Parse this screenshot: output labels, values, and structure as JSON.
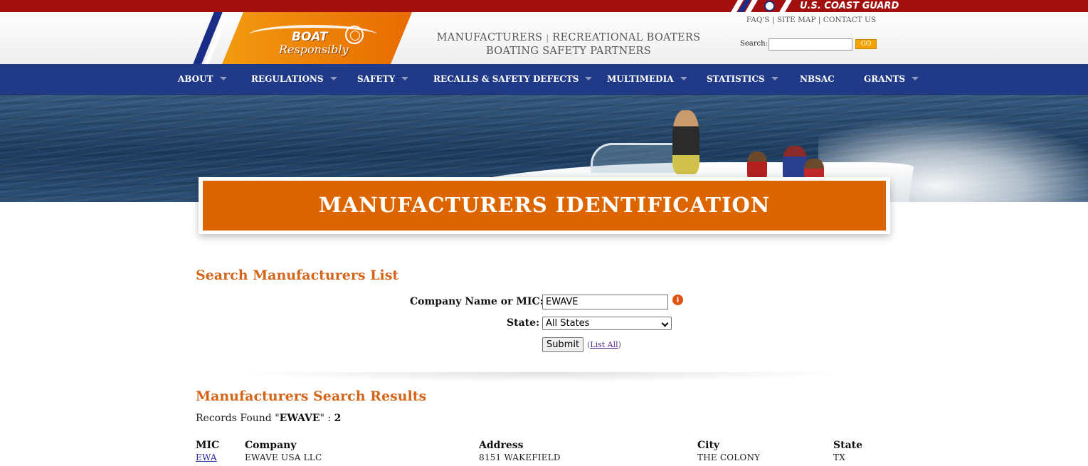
{
  "top_bar": {
    "agency_label": "U.S. COAST GUARD"
  },
  "header": {
    "logo_line1": "BOAT",
    "logo_line2": "Responsibly",
    "tagline_manufacturers": "MANUFACTURERS",
    "tagline_separator": "|",
    "tagline_boaters": "RECREATIONAL BOATERS",
    "tagline_partners": "BOATING SAFETY PARTNERS",
    "links": [
      "FAQ'S",
      "SITE MAP",
      "CONTACT US"
    ],
    "link_separator": "|",
    "search_label": "Search:",
    "search_value": "",
    "go_label": "GO"
  },
  "nav": {
    "items": [
      {
        "label": "ABOUT",
        "has_dropdown": true
      },
      {
        "label": "REGULATIONS",
        "has_dropdown": true
      },
      {
        "label": "SAFETY",
        "has_dropdown": true
      },
      {
        "label": "RECALLS & SAFETY DEFECTS",
        "has_dropdown": true
      },
      {
        "label": "MULTIMEDIA",
        "has_dropdown": true
      },
      {
        "label": "STATISTICS",
        "has_dropdown": true
      },
      {
        "label": "NBSAC",
        "has_dropdown": false
      },
      {
        "label": "GRANTS",
        "has_dropdown": true
      }
    ]
  },
  "banner": {
    "title": "MANUFACTURERS IDENTIFICATION"
  },
  "search": {
    "heading": "Search Manufacturers List",
    "company_label": "Company Name or MIC:",
    "company_value": "EWAVE",
    "info_icon": "i",
    "state_label": "State:",
    "state_selected": "All States",
    "submit_label": "Submit",
    "list_all_open": "(",
    "list_all_label": "List All",
    "list_all_close": ")"
  },
  "results": {
    "heading": "Manufacturers Search Results",
    "records_prefix": "Records Found \"",
    "query": "EWAVE",
    "records_mid": "\" : ",
    "count": "2",
    "columns": [
      "MIC",
      "Company",
      "Address",
      "City",
      "State"
    ],
    "rows": [
      {
        "mic": "EWA",
        "company": "EWAVE USA LLC",
        "address": "8151 WAKEFIELD",
        "city": "THE COLONY",
        "state": "TX"
      }
    ]
  },
  "colors": {
    "top_bar": "#a10f0f",
    "nav": "#213a87",
    "banner": "#dd6500",
    "heading": "#d4661c",
    "go_button": "#f2a300"
  }
}
